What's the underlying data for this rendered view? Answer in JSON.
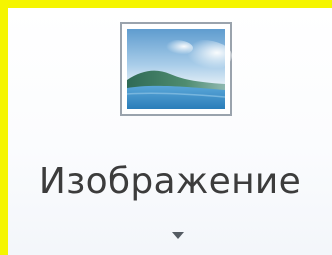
{
  "ribbon": {
    "picture_button": {
      "label": "Изображение",
      "icon": "picture-icon",
      "has_dropdown": true
    }
  },
  "colors": {
    "frame": "#f5f500",
    "label_text": "#3c3c3c",
    "icon_border": "#9aa3ad",
    "sky_top": "#6fa8d6",
    "water": "#3f8fc8"
  }
}
